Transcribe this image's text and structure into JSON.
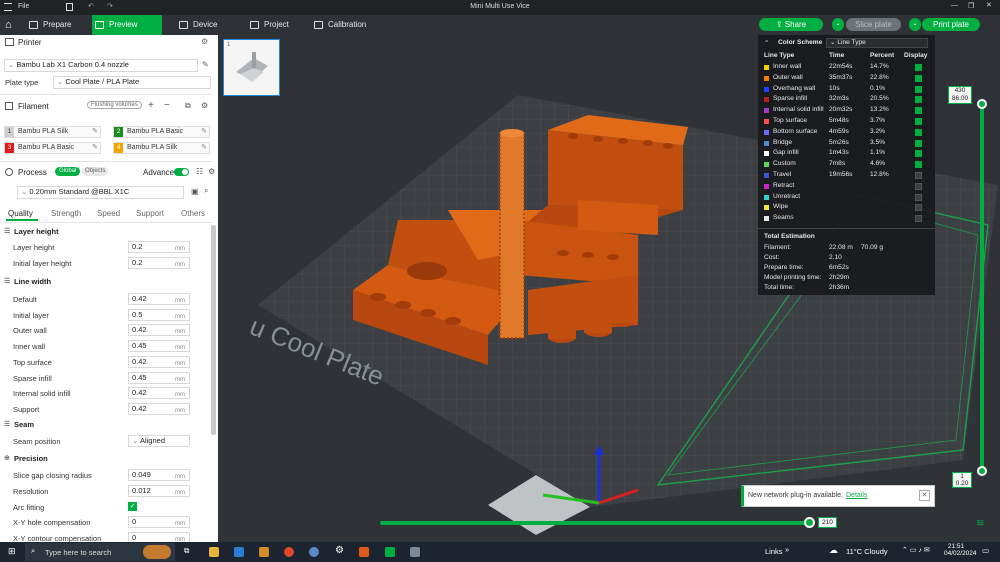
{
  "titlebar": {
    "menu": "File",
    "title": "Mini Multi Use Vice"
  },
  "toolbar": {
    "tabs": [
      {
        "label": "Prepare"
      },
      {
        "label": "Preview"
      },
      {
        "label": "Device"
      },
      {
        "label": "Project"
      },
      {
        "label": "Calibration"
      }
    ],
    "share": "Share",
    "slice": "Slice plate",
    "print": "Print plate"
  },
  "printer": {
    "heading": "Printer",
    "model": "Bambu Lab X1 Carbon 0.4 nozzle",
    "plate_label": "Plate type",
    "plate_value": "Cool Plate / PLA Plate"
  },
  "filament": {
    "heading": "Filament",
    "flush": "Flushing volumes",
    "slots": [
      {
        "num": "1",
        "name": "Bambu PLA Silk",
        "color": "#c8c8c8"
      },
      {
        "num": "2",
        "name": "Bambu PLA Basic",
        "color": "#1f8a1f"
      },
      {
        "num": "3",
        "name": "Bambu PLA Basic",
        "color": "#e01b1b"
      },
      {
        "num": "4",
        "name": "Bambu PLA Silk",
        "color": "#f0a500"
      }
    ]
  },
  "process": {
    "heading": "Process",
    "global": "Global",
    "objects": "Objects",
    "advanced": "Advance",
    "preset": "0.20mm Standard @BBL X1C",
    "tabs": [
      "Quality",
      "Strength",
      "Speed",
      "Support",
      "Others"
    ]
  },
  "quality": {
    "layer_height_h": "Layer height",
    "layer_height": {
      "label": "Layer height",
      "value": "0.2",
      "unit": "mm"
    },
    "initial_layer_height": {
      "label": "Initial layer height",
      "value": "0.2",
      "unit": "mm"
    },
    "line_width_h": "Line width",
    "line_widths": [
      {
        "label": "Default",
        "value": "0.42",
        "unit": "mm"
      },
      {
        "label": "Initial layer",
        "value": "0.5",
        "unit": "mm"
      },
      {
        "label": "Outer wall",
        "value": "0.42",
        "unit": "mm"
      },
      {
        "label": "Inner wall",
        "value": "0.45",
        "unit": "mm"
      },
      {
        "label": "Top surface",
        "value": "0.42",
        "unit": "mm"
      },
      {
        "label": "Sparse infill",
        "value": "0.45",
        "unit": "mm"
      },
      {
        "label": "Internal solid infill",
        "value": "0.42",
        "unit": "mm"
      },
      {
        "label": "Support",
        "value": "0.42",
        "unit": "mm"
      }
    ],
    "seam_h": "Seam",
    "seam_position": {
      "label": "Seam position",
      "value": "Aligned"
    },
    "precision_h": "Precision",
    "slice_gap": {
      "label": "Slice gap closing radius",
      "value": "0.049",
      "unit": "mm"
    },
    "resolution": {
      "label": "Resolution",
      "value": "0.012",
      "unit": "mm"
    },
    "arc_fitting": {
      "label": "Arc fitting",
      "checked": true
    },
    "xy_hole": {
      "label": "X-Y hole compensation",
      "value": "0",
      "unit": "mm"
    },
    "xy_contour": {
      "label": "X-Y contour compensation",
      "value": "0",
      "unit": "mm"
    }
  },
  "stats": {
    "color_scheme_label": "Color Scheme",
    "color_scheme_value": "Line Type",
    "headers": [
      "Line Type",
      "Time",
      "Percent",
      "Display"
    ],
    "rows": [
      {
        "type": "Inner wall",
        "time": "22m54s",
        "percent": "14.7%",
        "color": "#f2d100",
        "display": true
      },
      {
        "type": "Outer wall",
        "time": "35m37s",
        "percent": "22.8%",
        "color": "#ff7a00",
        "display": true
      },
      {
        "type": "Overhang wall",
        "time": "10s",
        "percent": "0.1%",
        "color": "#1f3cff",
        "display": true
      },
      {
        "type": "Sparse infill",
        "time": "32m3s",
        "percent": "20.5%",
        "color": "#b8211f",
        "display": true
      },
      {
        "type": "Internal solid infill",
        "time": "20m32s",
        "percent": "13.2%",
        "color": "#a03cc8",
        "display": true
      },
      {
        "type": "Top surface",
        "time": "5m48s",
        "percent": "3.7%",
        "color": "#ff4d4d",
        "display": true
      },
      {
        "type": "Bottom surface",
        "time": "4m59s",
        "percent": "3.2%",
        "color": "#6a6aff",
        "display": true
      },
      {
        "type": "Bridge",
        "time": "5m26s",
        "percent": "3.5%",
        "color": "#4a8ad4",
        "display": true
      },
      {
        "type": "Gap infill",
        "time": "1m43s",
        "percent": "1.1%",
        "color": "#ffffff",
        "display": true
      },
      {
        "type": "Custom",
        "time": "7m8s",
        "percent": "4.6%",
        "color": "#5fd35f",
        "display": true
      },
      {
        "type": "Travel",
        "time": "19m56s",
        "percent": "12.8%",
        "color": "#3858d6",
        "display": false
      },
      {
        "type": "Retract",
        "time": "",
        "percent": "",
        "color": "#d020d0",
        "display": false
      },
      {
        "type": "Unretract",
        "time": "",
        "percent": "",
        "color": "#30d0d0",
        "display": false
      },
      {
        "type": "Wipe",
        "time": "",
        "percent": "",
        "color": "#f5e640",
        "display": false
      },
      {
        "type": "Seams",
        "time": "",
        "percent": "",
        "color": "#e8e8e8",
        "display": false
      }
    ],
    "total_h": "Total Estimation",
    "totals": [
      {
        "label": "Filament:",
        "value": "22.08 m",
        "value2": "70.09 g"
      },
      {
        "label": "Cost:",
        "value": "2.10",
        "value2": ""
      },
      {
        "label": "Prepare time:",
        "value": "6m52s",
        "value2": ""
      },
      {
        "label": "Model printing time:",
        "value": "2h29m",
        "value2": ""
      },
      {
        "label": "Total time:",
        "value": "2h36m",
        "value2": ""
      }
    ]
  },
  "layer_slider": {
    "top_layer": "430",
    "top_height": "86.00",
    "bottom_layer": "1",
    "bottom_height": "0.20"
  },
  "move_slider": {
    "value": "210"
  },
  "plate_text": "u Cool Plate",
  "notification": {
    "text": "New network plug-in available.",
    "link": "Details"
  },
  "taskbar": {
    "search": "Type here to search",
    "links": "Links",
    "weather": "11°C Cloudy",
    "time": "21:51",
    "date": "04/02/2024"
  }
}
